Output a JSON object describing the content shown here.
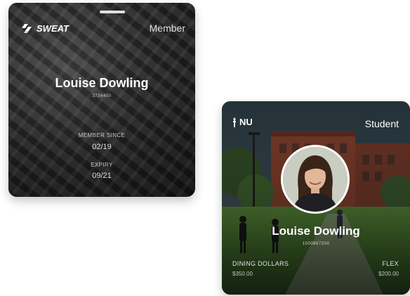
{
  "membership_card": {
    "brand": "SWEAT",
    "tier": "Member",
    "name": "Louise Dowling",
    "id_text": "3736400",
    "member_since_label": "MEMBER SINCE",
    "member_since_value": "02/19",
    "expiry_label": "EXPIRY",
    "expiry_value": "09/21"
  },
  "student_card": {
    "brand": "NU",
    "tier": "Student",
    "name": "Louise Dowling",
    "id_text": "1000887200",
    "dining_label": "DINING DOLLARS",
    "dining_value": "$350.00",
    "flex_label": "FLEX",
    "flex_value": "$200.00"
  },
  "colors": {
    "card_text": "#ffffff",
    "card1_bg": "#3e3e3e",
    "card2_sky": "#2f3d45",
    "card2_building": "#7a3b2a",
    "card2_grass": "#3f6a2c"
  },
  "icons": {
    "sweat_logo": "diagonal-stripes-logo",
    "nu_logo": "torch-logo"
  }
}
